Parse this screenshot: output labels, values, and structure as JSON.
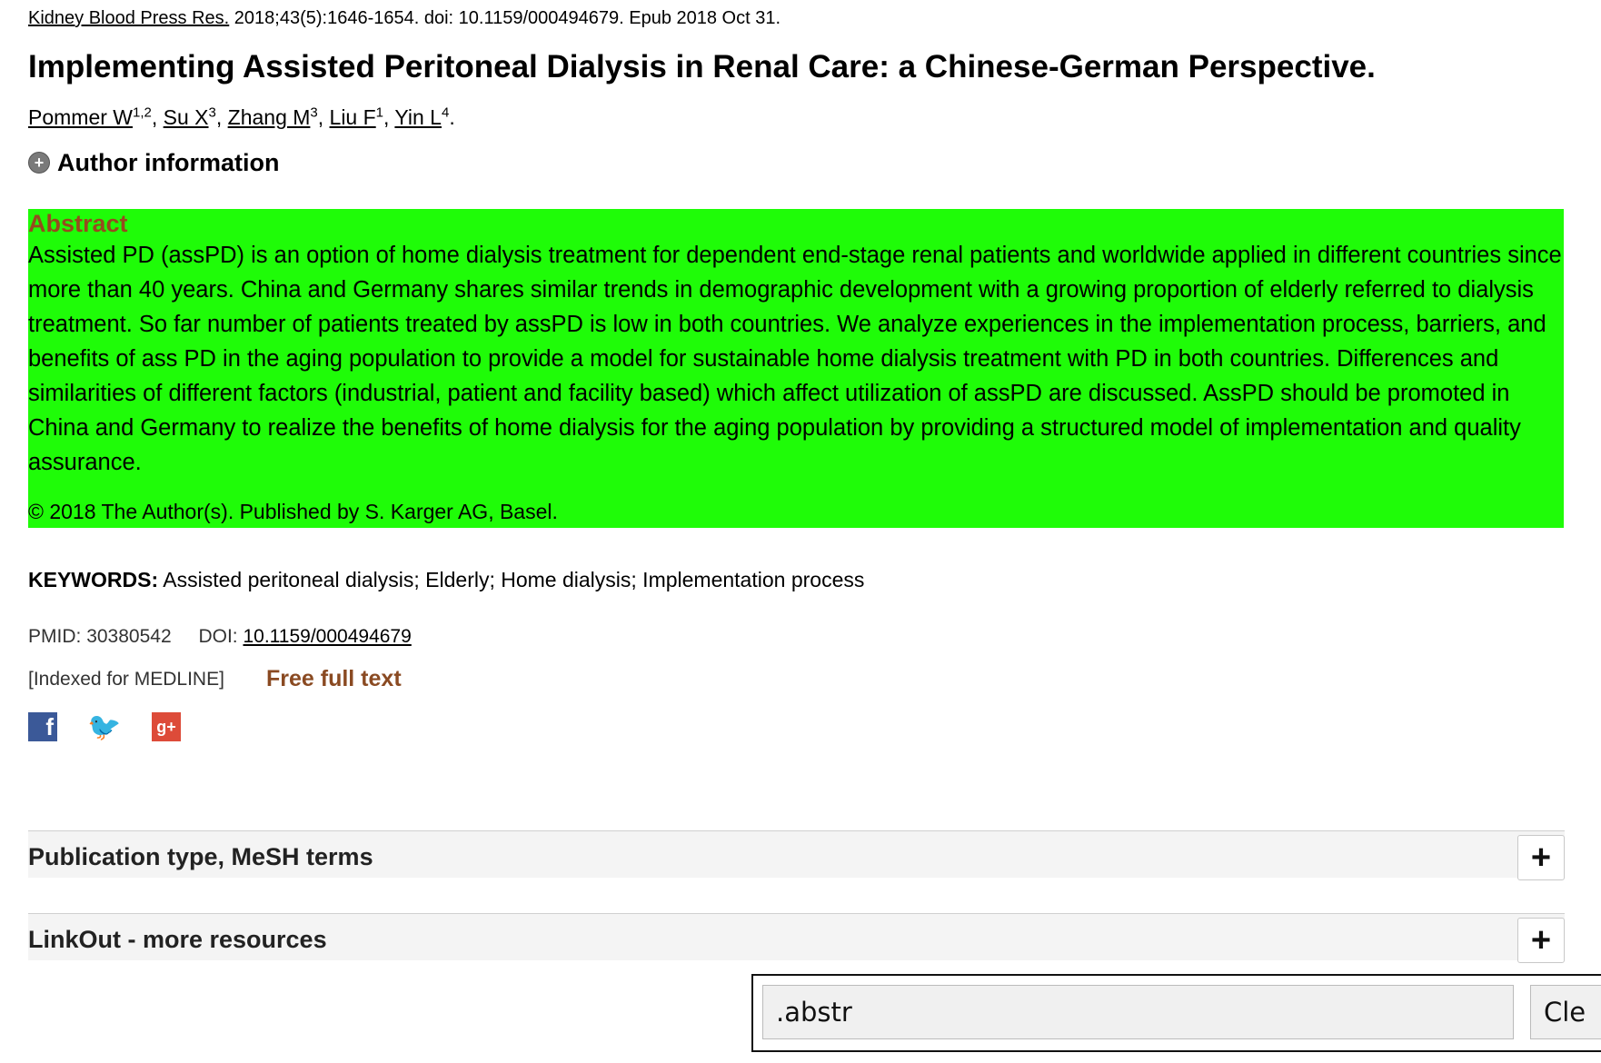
{
  "citation": {
    "journal": "Kidney Blood Press Res.",
    "details": "2018;43(5):1646-1654. doi: 10.1159/000494679. Epub 2018 Oct 31."
  },
  "title": "Implementing Assisted Peritoneal Dialysis in Renal Care: a Chinese-German Perspective.",
  "authors": [
    {
      "name": "Pommer W",
      "sup": "1,2"
    },
    {
      "name": "Su X",
      "sup": "3"
    },
    {
      "name": "Zhang M",
      "sup": "3"
    },
    {
      "name": "Liu F",
      "sup": "1"
    },
    {
      "name": "Yin L",
      "sup": "4"
    }
  ],
  "author_info": {
    "label": "Author information",
    "icon": "plus-circle-icon"
  },
  "abstract": {
    "heading": "Abstract",
    "text": "Assisted PD (assPD) is an option of home dialysis treatment for dependent end-stage renal patients and worldwide applied in different countries since more than 40 years. China and Germany shares similar trends in demographic development with a growing proportion of elderly referred to dialysis treatment. So far number of patients treated by assPD is low in both countries. We analyze experiences in the implementation process, barriers, and benefits of ass PD in the aging population to provide a model for sustainable home dialysis treatment with PD in both countries. Differences and similarities of different factors (industrial, patient and facility based) which affect utilization of assPD are discussed. AssPD should be promoted in China and Germany to realize the benefits of home dialysis for the aging population by providing a structured model of implementation and quality assurance.",
    "copyright": "© 2018 The Author(s). Published by S. Karger AG, Basel.",
    "highlight_color": "#1ffc08"
  },
  "keywords": {
    "label": "KEYWORDS:",
    "value": "Assisted peritoneal dialysis; Elderly; Home dialysis; Implementation process"
  },
  "ids": {
    "pmid_label": "PMID:",
    "pmid": "30380542",
    "doi_label": "DOI:",
    "doi": "10.1159/000494679"
  },
  "indexed": "[Indexed for MEDLINE]",
  "free_full_text": "Free full text",
  "social": {
    "facebook": {
      "glyph": "f",
      "icon": "facebook-icon"
    },
    "twitter": {
      "glyph": "🐦",
      "icon": "twitter-icon"
    },
    "googleplus": {
      "glyph": "g+",
      "icon": "google-plus-icon"
    }
  },
  "panels": [
    {
      "title": "Publication type, MeSH terms",
      "button": "+"
    },
    {
      "title": "LinkOut - more resources",
      "button": "+"
    }
  ],
  "search": {
    "value": ".abstr",
    "clear_label": "Cle"
  }
}
